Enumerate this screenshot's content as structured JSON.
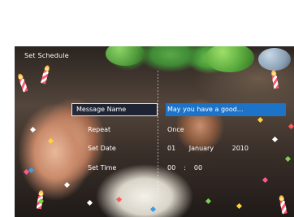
{
  "screen": {
    "title": "Set Schedule"
  },
  "menu": {
    "items": [
      {
        "label": "Message Name",
        "value": "May you have a good...",
        "selected": true
      },
      {
        "label": "Repeat",
        "value": "Once"
      },
      {
        "label": "Set Date",
        "day": "01",
        "month": "January",
        "year": "2010"
      },
      {
        "label": "Set Time",
        "hour": "00",
        "separator": ":",
        "minute": "00"
      }
    ]
  },
  "colors": {
    "selection": "#1d73c8",
    "text": "#ffffff"
  },
  "icons": [
    "confetti-icon",
    "candle-icon",
    "balloon-icon"
  ]
}
